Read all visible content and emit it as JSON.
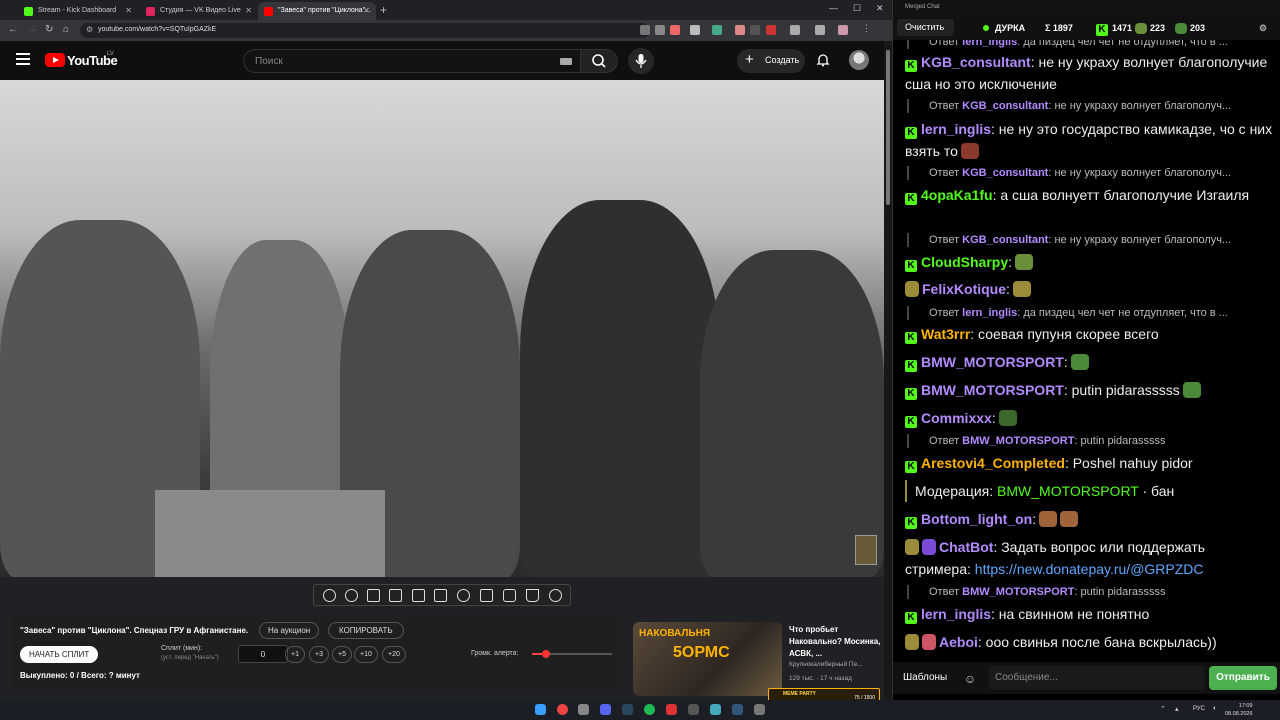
{
  "browser": {
    "tabs": [
      {
        "title": "Stream - Kick Dashboard",
        "color": "#53fc18"
      },
      {
        "title": "Студия — VK Видео Live",
        "color": "#e0245e"
      },
      {
        "title": "\"Завеса\" против \"Циклона\"...",
        "color": "#ff0000"
      }
    ],
    "new_tab": "+",
    "url": "youtube.com/watch?v=SQTuIpGAZkE"
  },
  "youtube": {
    "logo_text": "YouTube",
    "region": "LV",
    "search_placeholder": "Поиск",
    "create_label": "Создать"
  },
  "panel": {
    "title": "\"Завеса\" против \"Циклона\". Спецназ ГРУ в Афганистане.",
    "auction_label": "На аукцион",
    "copy_label": "КОПИРОВАТЬ",
    "start_label": "НАЧАТЬ СПЛИТ",
    "split_label": "Сплит (мин):",
    "split_hint": "(уст. перед \"Начать\")",
    "split_value": "0",
    "increments": [
      "+1",
      "+3",
      "+5",
      "+10",
      "+20"
    ],
    "volume_label": "Громк. алерта:",
    "volume_level": 0.17,
    "bought": "Выкуплено: 0 / Всего: ? минут"
  },
  "recommendation": {
    "thumb_line1": "НАКОВАЛЬНЯ",
    "thumb_line2": "5ОРМС",
    "title": "Что пробьет Наковально? Мосинка, АСВК, ...",
    "channel": "Крупнокалиберный Пе...",
    "meta": "129 тыс. · 17 ч назад",
    "meme_label": "MEME PARTY",
    "meme_count": "75 / 1500"
  },
  "chat": {
    "window_title": "Merged Chat",
    "clear_label": "Очистить",
    "stats": {
      "name": "ДУРКА",
      "sum": "Σ 1897",
      "kick": "1471",
      "other1": "223",
      "other2": "203"
    },
    "messages": [
      {
        "type": "reply",
        "prefix": "Ответ",
        "user": "lern_inglis",
        "text": ": да пиздец чел чет не отдупляет, что в ..."
      },
      {
        "type": "msg",
        "user": "KGB_consultant",
        "color": "#b48bff",
        "text": ": не ну украху волнует благополучие сша но это исключение"
      },
      {
        "type": "reply",
        "prefix": "Ответ",
        "user": "KGB_consultant",
        "text": ": не ну украху волнует благополуч..."
      },
      {
        "type": "msg",
        "user": "lern_inglis",
        "color": "#b48bff",
        "text": ": не ну это государство камикадзе, чо с них взять то"
      },
      {
        "type": "reply",
        "prefix": "Ответ",
        "user": "KGB_consultant",
        "text": ": не ну украху волнует благополуч..."
      },
      {
        "type": "msg",
        "user": "4opaKa1fu",
        "color": "#53fc18",
        "text": ": а сша волнуетт благополучие Изгаиля"
      },
      {
        "type": "reply",
        "prefix": "Ответ",
        "user": "KGB_consultant",
        "text": ": не ну украху волнует благополуч..."
      },
      {
        "type": "msg",
        "user": "CloudSharpy",
        "color": "#53fc18",
        "text": ":"
      },
      {
        "type": "msg",
        "user": "FelixKotique",
        "color": "#b48bff",
        "text": ":"
      },
      {
        "type": "reply",
        "prefix": "Ответ",
        "user": "lern_inglis",
        "text": ": да пиздец чел чет не отдупляет, что в ..."
      },
      {
        "type": "msg",
        "user": "Wat3rrr",
        "color": "#ffb300",
        "text": ": соевая пупуня скорее всего"
      },
      {
        "type": "msg",
        "user": "BMW_MOTORSPORT",
        "color": "#b48bff",
        "text": ":"
      },
      {
        "type": "msg",
        "user": "BMW_MOTORSPORT",
        "color": "#b48bff",
        "text": ": putin pidarasssss"
      },
      {
        "type": "msg",
        "user": "Commixxx",
        "color": "#b48bff",
        "text": ":"
      },
      {
        "type": "reply",
        "prefix": "Ответ",
        "user": "BMW_MOTORSPORT",
        "text": ": putin pidarasssss"
      },
      {
        "type": "msg",
        "user": "Arestovi4_Completed",
        "color": "#ffb300",
        "text": ": Poshel nahuy pidor"
      },
      {
        "type": "mod",
        "prefix": "Модерация:",
        "user": "BMW_MOTORSPORT",
        "text": "· бан"
      },
      {
        "type": "msg",
        "user": "Bottom_light_on",
        "color": "#b48bff",
        "text": ":"
      },
      {
        "type": "msg",
        "user": "ChatBot",
        "color": "#b48bff",
        "text": ": Задать вопрос или поддержать стримера:",
        "link": "https://new.donatepay.ru/@GRPZDC"
      },
      {
        "type": "reply",
        "prefix": "Ответ",
        "user": "BMW_MOTORSPORT",
        "text": ": putin pidarasssss"
      },
      {
        "type": "msg",
        "user": "lern_inglis",
        "color": "#b48bff",
        "text": ": на свинном не понятно"
      },
      {
        "type": "msg",
        "user": "Aeboi",
        "color": "#b48bff",
        "text": ": ооо свинья после бана вскрылась))"
      }
    ],
    "templates_label": "Шаблоны",
    "input_placeholder": "Сообщение...",
    "send_label": "Отправить"
  },
  "taskbar": {
    "lang": "РУС",
    "time": "17:09",
    "date": "08.08.2026"
  }
}
